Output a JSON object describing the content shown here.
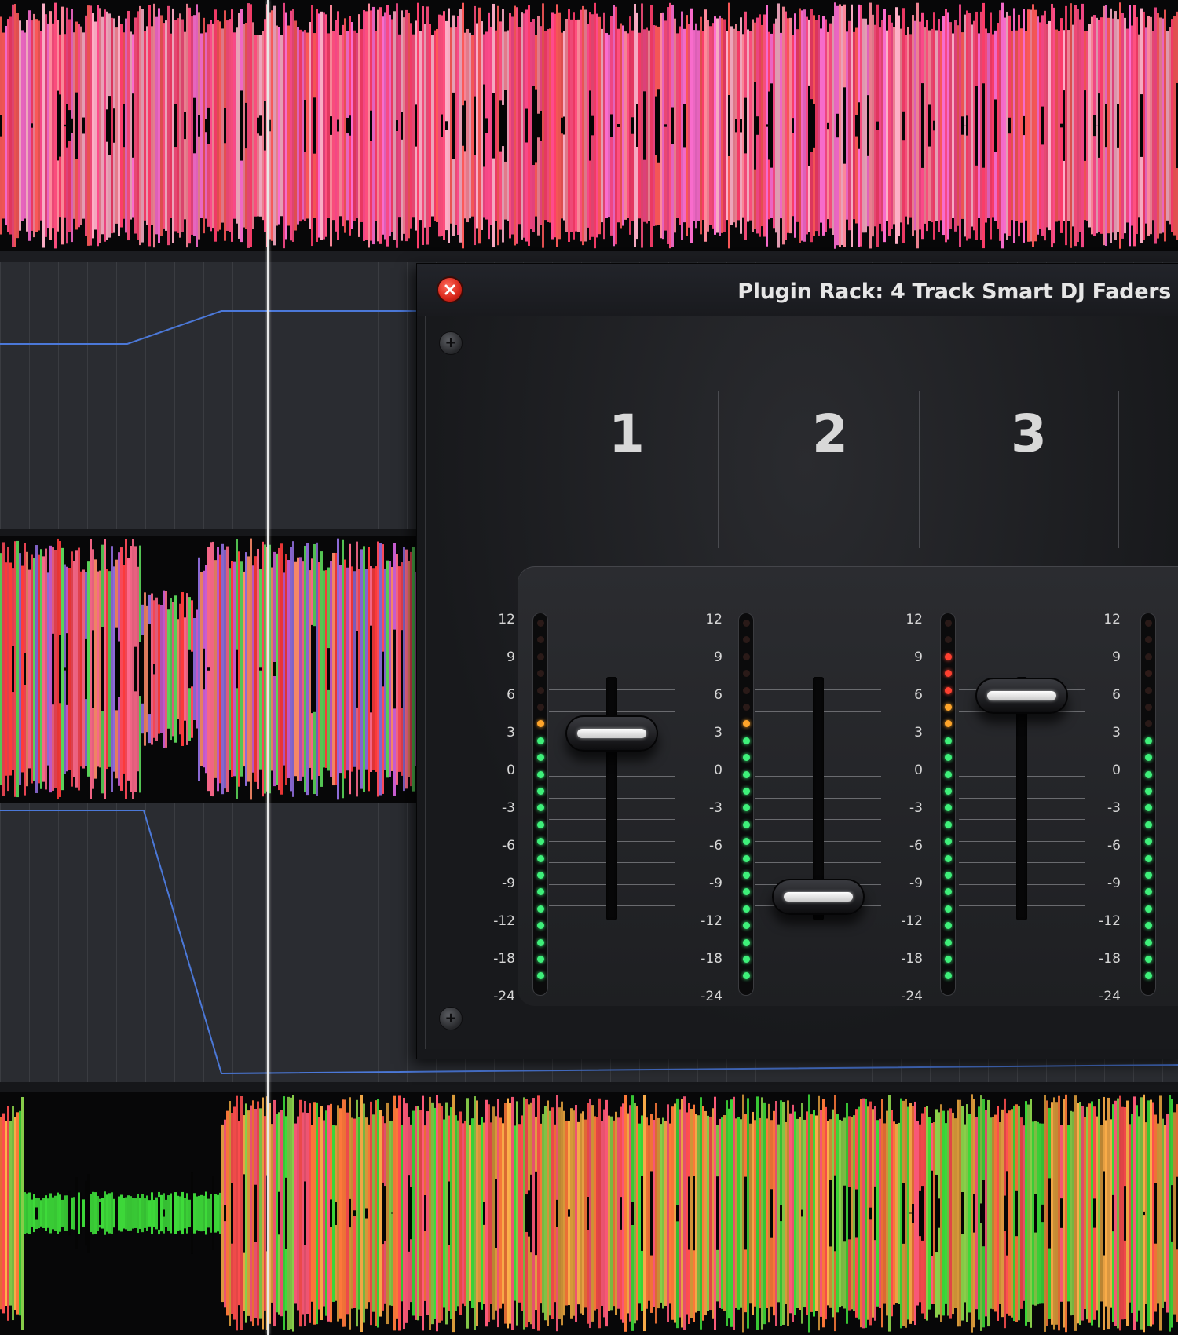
{
  "plugin_rack": {
    "title": "Plugin Rack: 4 Track Smart DJ Faders",
    "close_icon": "close-icon",
    "screw_icon": "plus-screw-icon",
    "channels": [
      {
        "label": "1",
        "fader_level_db": 3,
        "meter_peak_db": 3
      },
      {
        "label": "2",
        "fader_level_db": -10,
        "meter_peak_db": 3
      },
      {
        "label": "3",
        "fader_level_db": 6,
        "meter_peak_db": 9
      },
      {
        "label": "",
        "fader_level_db": null,
        "meter_peak_db": 0
      }
    ],
    "scale_labels": [
      "12",
      "9",
      "6",
      "3",
      "0",
      "-3",
      "-6",
      "-9",
      "-12",
      "-18",
      "-24"
    ]
  },
  "colors": {
    "accent_blue": "#4b78d8",
    "close_red": "#e0301e",
    "meter_green": "#3ef07a",
    "meter_orange": "#ffa52a",
    "meter_red": "#ff4030",
    "wave_pink": "#ff4f7f",
    "wave_green": "#3edc3a"
  }
}
